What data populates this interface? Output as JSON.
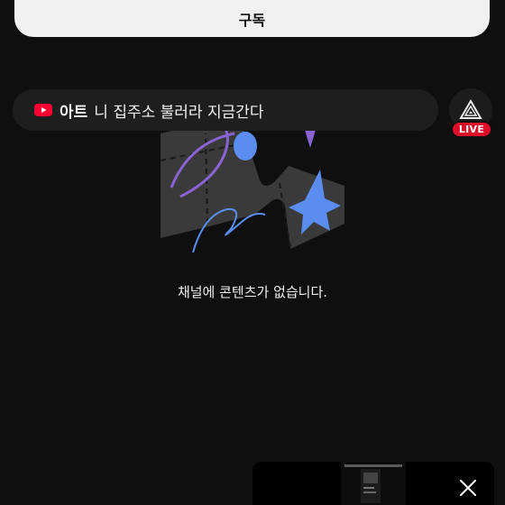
{
  "subscribe": {
    "label": "구독"
  },
  "live_banner": {
    "icon": "youtube-icon",
    "channel": "아트",
    "title": "니 집주소 불러라 지금간다",
    "badge": "LIVE",
    "avatar_icon": "triangle-logo-icon"
  },
  "empty_state": {
    "message": "채널에 콘텐츠가 없습니다.",
    "illustration": "empty-channel-illustration"
  },
  "mini_player": {
    "close_icon": "close-icon"
  },
  "colors": {
    "background": "#0f0f0f",
    "subscribe_bg": "#f1f1f1",
    "live_red": "#e00d28",
    "accent_purple": "#8a63d2",
    "accent_blue": "#5b8def"
  }
}
